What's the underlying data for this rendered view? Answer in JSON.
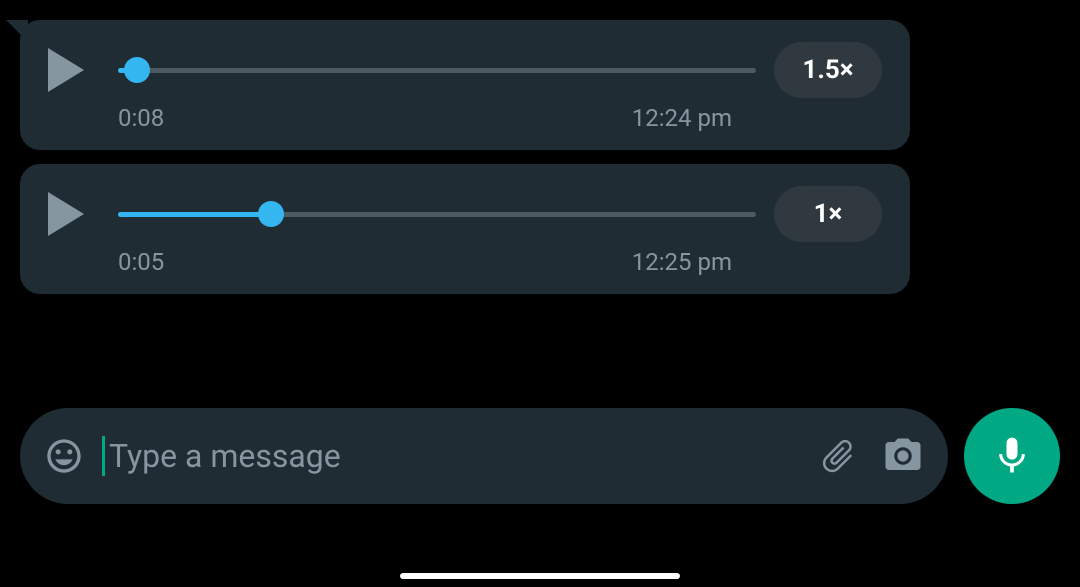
{
  "messages": [
    {
      "type": "voice",
      "duration": "0:08",
      "timestamp": "12:24 pm",
      "speed": "1.5×",
      "progress_percent": 3,
      "thumb_percent": 3
    },
    {
      "type": "voice",
      "duration": "0:05",
      "timestamp": "12:25 pm",
      "speed": "1×",
      "progress_percent": 24,
      "thumb_percent": 24
    }
  ],
  "composer": {
    "placeholder": "Type a message",
    "value": ""
  },
  "colors": {
    "accent_blue": "#34B7F1",
    "accent_teal": "#00A884",
    "bubble_bg": "#1F2C34",
    "muted": "#8696A0"
  },
  "icons": {
    "emoji": "emoji-smile-icon",
    "attach": "paperclip-icon",
    "camera": "camera-icon",
    "mic": "microphone-icon",
    "play": "play-icon"
  }
}
